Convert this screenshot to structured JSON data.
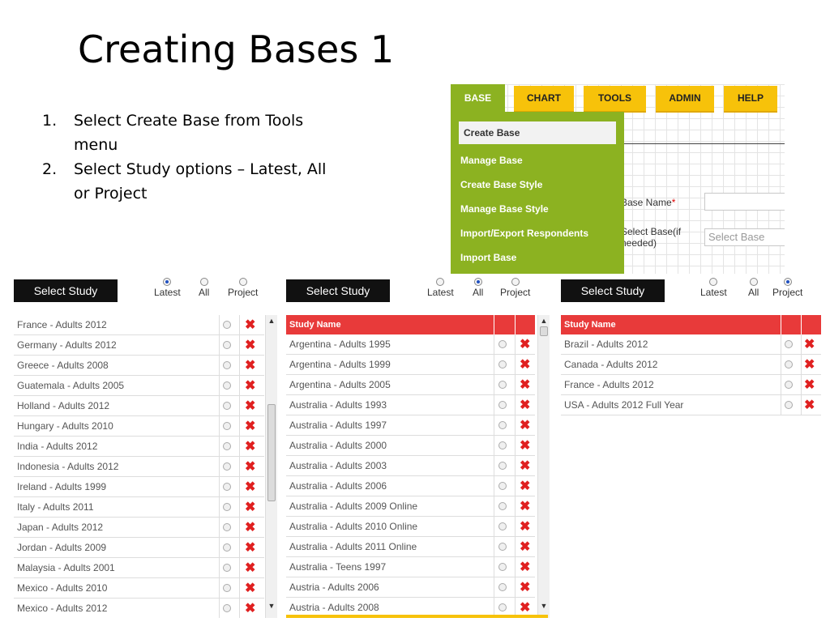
{
  "slide": {
    "title": "Creating Bases 1",
    "steps": [
      {
        "num": "1.",
        "text": "Select Create Base from Tools menu"
      },
      {
        "num": "2.",
        "text": "Select  Study options – Latest, All or Project"
      }
    ]
  },
  "menu_screenshot": {
    "tabs": {
      "base": "BASE",
      "chart": "CHART",
      "tools": "TOOLS",
      "admin": "ADMIN",
      "help": "HELP"
    },
    "dropdown": [
      "Create Base",
      "Manage Base",
      "Create Base Style",
      "Manage Base Style",
      "Import/Export Respondents",
      "Import Base"
    ],
    "form": {
      "base_name_label": "Base Name",
      "required_mark": "*",
      "select_base_label_1": "Select Base(if",
      "select_base_label_2": "needed)",
      "select_base_placeholder": "Select Base"
    },
    "colors": {
      "active_tab": "#8cb221",
      "tab": "#f7c20a"
    }
  },
  "panels": {
    "select_study_label": "Select Study",
    "options": {
      "latest": "Latest",
      "all": "All",
      "project": "Project"
    },
    "table_header": "Study Name",
    "latest": {
      "selected": "Latest",
      "rows": [
        "France - Adults 2012",
        "Germany - Adults 2012",
        "Greece - Adults 2008",
        "Guatemala - Adults 2005",
        "Holland - Adults 2012",
        "Hungary - Adults 2010",
        "India - Adults 2012",
        "Indonesia - Adults 2012",
        "Ireland - Adults 1999",
        "Italy - Adults 2011",
        "Japan - Adults 2012",
        "Jordan - Adults 2009",
        "Malaysia - Adults 2001",
        "Mexico - Adults 2010",
        "Mexico - Adults 2012"
      ]
    },
    "all": {
      "selected": "All",
      "rows": [
        "Argentina - Adults 1995",
        "Argentina - Adults 1999",
        "Argentina - Adults 2005",
        "Australia - Adults 1993",
        "Australia - Adults 1997",
        "Australia - Adults 2000",
        "Australia - Adults 2003",
        "Australia - Adults 2006",
        "Australia - Adults 2009 Online",
        "Australia - Adults 2010 Online",
        "Australia - Adults 2011 Online",
        "Australia - Teens 1997",
        "Austria - Adults 2006",
        "Austria - Adults 2008"
      ]
    },
    "project": {
      "selected": "Project",
      "rows": [
        "Brazil - Adults 2012",
        "Canada - Adults 2012",
        "France - Adults 2012",
        "USA - Adults 2012 Full Year"
      ]
    },
    "colors": {
      "header_red": "#e83a3a",
      "delete_red": "#e02020",
      "radio_selected": "#2050c0"
    }
  }
}
